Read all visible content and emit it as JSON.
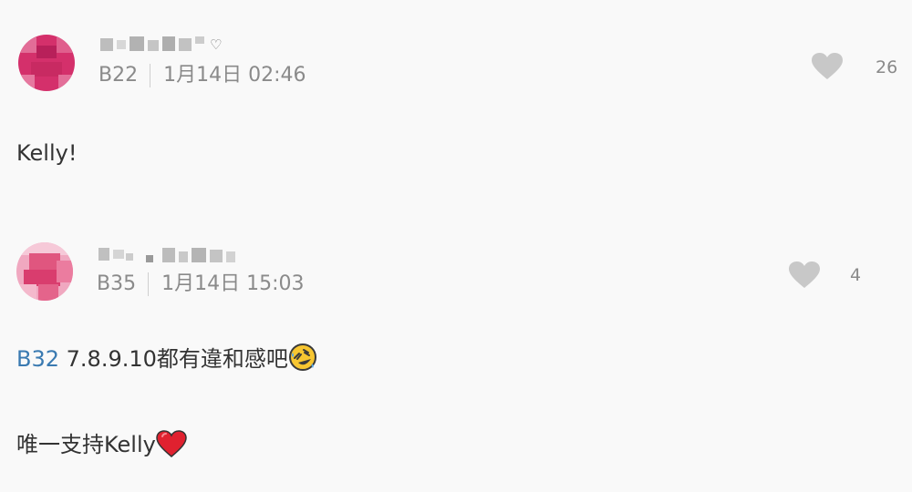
{
  "comments": [
    {
      "floor": "B22",
      "time": "1月14日 02:46",
      "likes": "26",
      "body": [
        "Kelly!"
      ],
      "avatar_color": "#d0306a",
      "liked": false
    },
    {
      "floor": "B35",
      "time": "1月14日 15:03",
      "likes": "4",
      "reply_to": "B32",
      "body": [
        "7.8.9.10都有違和感吧",
        "唯一支持Kelly"
      ],
      "emoji": [
        "rolling-on-floor-laughing-icon",
        "red-heart-icon"
      ],
      "avatar_color": "#e8729a",
      "liked": false
    }
  ],
  "colors": {
    "background": "#f9f9f9",
    "link": "#3a7ab1",
    "meta_text": "#8a8a8a",
    "like_icon": "#c8c8c8",
    "heart_emoji": "#e0212f"
  }
}
